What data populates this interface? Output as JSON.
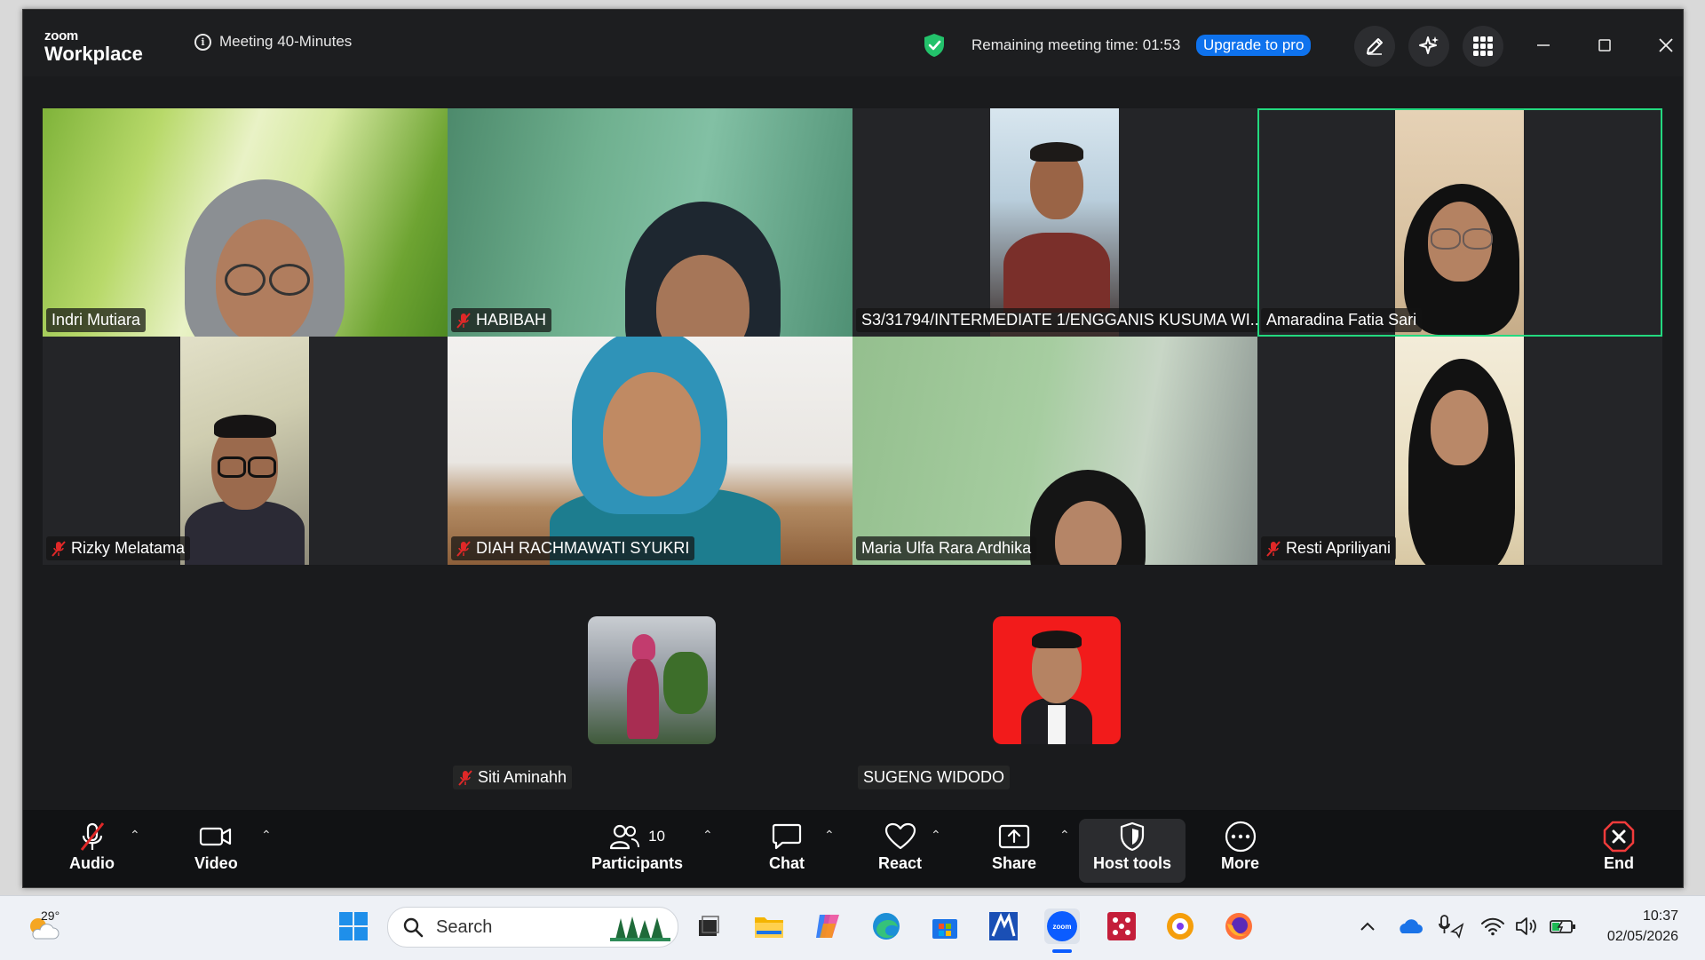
{
  "titlebar": {
    "brand_line1": "zoom",
    "brand_line2": "Workplace",
    "meeting_label": "Meeting 40-Minutes",
    "remaining_time": "Remaining meeting time: 01:53",
    "upgrade_label": "Upgrade to pro"
  },
  "participants": [
    {
      "name": "Indri Mutiara",
      "muted": false
    },
    {
      "name": "HABIBAH",
      "muted": true
    },
    {
      "name": "S3/31794/INTERMEDIATE 1/ENGGANIS KUSUMA WI...",
      "muted": false
    },
    {
      "name": "Amaradina Fatia Sari",
      "muted": false,
      "active_speaker": true
    },
    {
      "name": "Rizky Melatama",
      "muted": true
    },
    {
      "name": "DIAH RACHMAWATI SYUKRI",
      "muted": true
    },
    {
      "name": "Maria Ulfa Rara Ardhika",
      "muted": false
    },
    {
      "name": "Resti Apriliyani",
      "muted": true
    },
    {
      "name": "Siti Aminahh",
      "muted": true
    },
    {
      "name": "SUGENG WIDODO",
      "muted": false
    }
  ],
  "toolbar": {
    "audio": "Audio",
    "video": "Video",
    "participants": "Participants",
    "participant_count": "10",
    "chat": "Chat",
    "react": "React",
    "share": "Share",
    "host_tools": "Host tools",
    "more": "More",
    "end": "End"
  },
  "taskbar": {
    "weather_temp": "29°",
    "search_placeholder": "Search",
    "time": "10:37",
    "date": "02/05/2026"
  },
  "colors": {
    "accent_blue": "#0e72ed",
    "active_speaker_border": "#23d97f",
    "muted_red": "#e02828",
    "window_bg": "#1a1b1d"
  }
}
